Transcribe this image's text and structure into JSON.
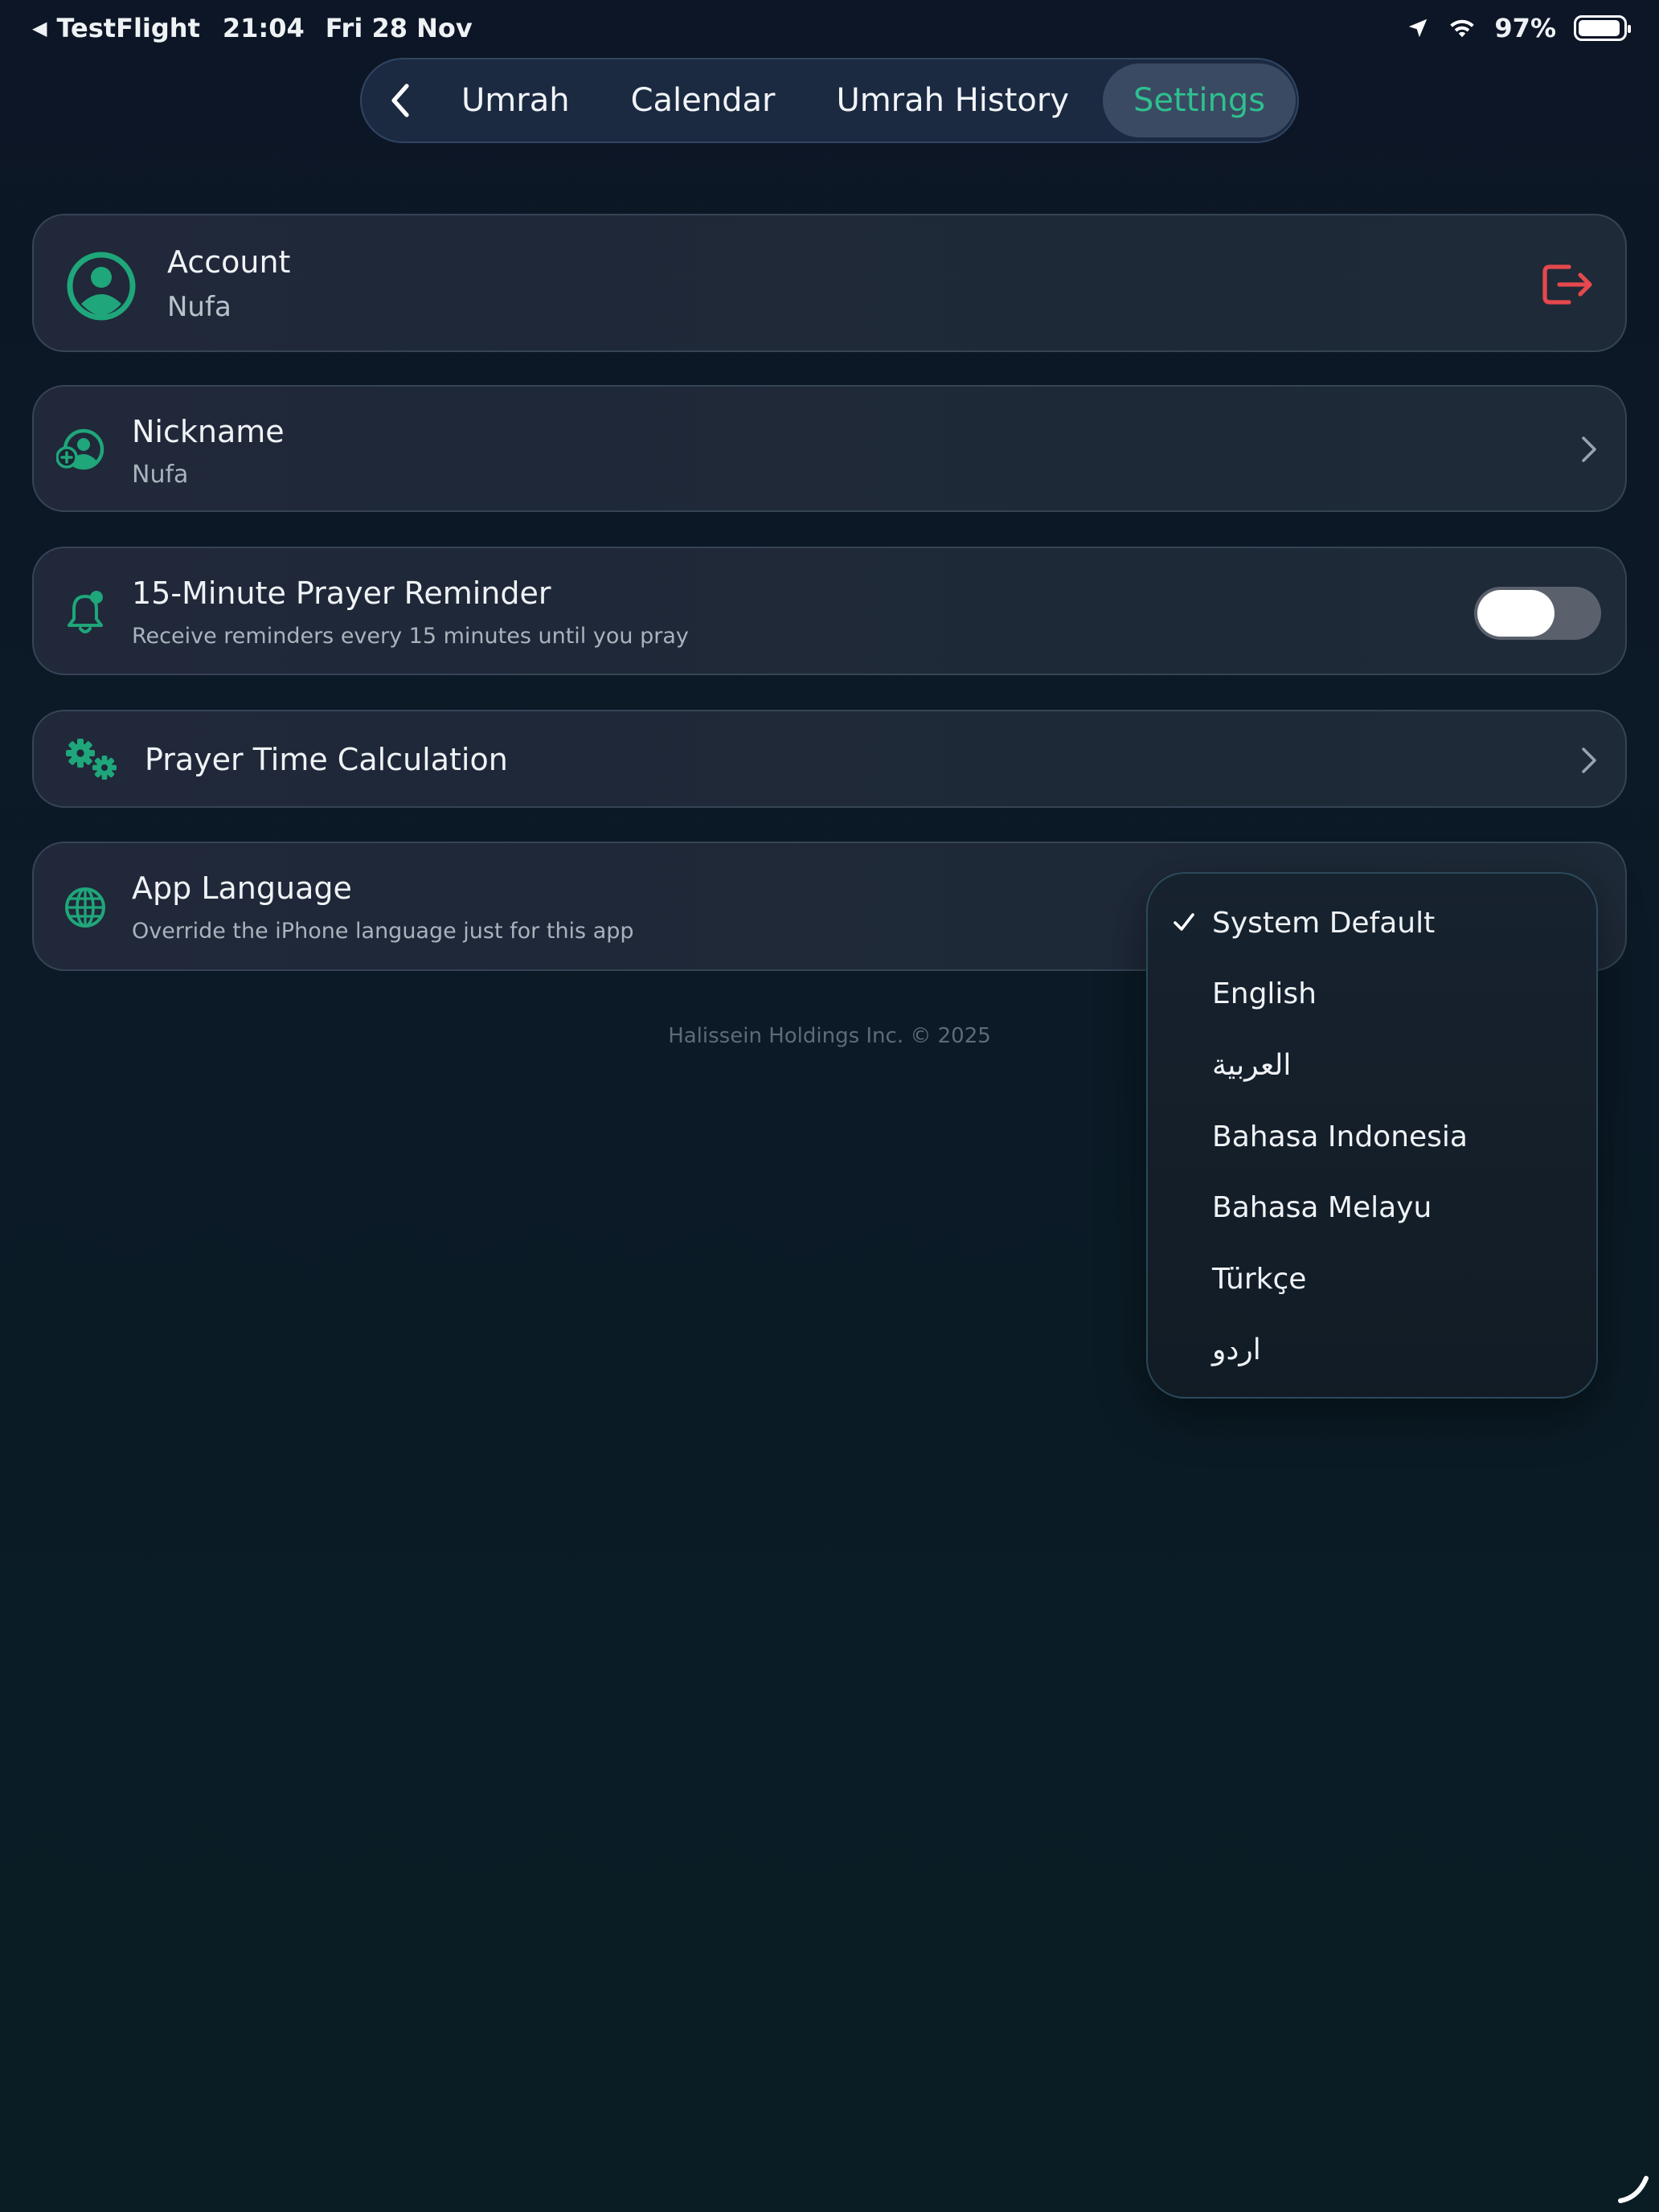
{
  "status_bar": {
    "back_app": "TestFlight",
    "time": "21:04",
    "date": "Fri 28 Nov",
    "battery": "97%"
  },
  "tabs": [
    {
      "label": "Umrah"
    },
    {
      "label": "Calendar"
    },
    {
      "label": "Umrah History"
    },
    {
      "label": "Settings"
    }
  ],
  "account": {
    "title": "Account",
    "name": "Nufa"
  },
  "nickname": {
    "title": "Nickname",
    "value": "Nufa"
  },
  "reminder": {
    "title": "15-Minute Prayer Reminder",
    "subtitle": "Receive reminders every 15 minutes until you pray",
    "enabled": false
  },
  "prayer_calc": {
    "title": "Prayer Time Calculation"
  },
  "language": {
    "title": "App Language",
    "subtitle": "Override the iPhone language just for this app",
    "selected": "System Default",
    "options": [
      {
        "label": "System Default"
      },
      {
        "label": "English"
      },
      {
        "label": "العربية"
      },
      {
        "label": "Bahasa Indonesia"
      },
      {
        "label": "Bahasa Melayu"
      },
      {
        "label": "Türkçe"
      },
      {
        "label": "اردو"
      }
    ]
  },
  "footer": "Halissein Holdings Inc. © 2025",
  "colors": {
    "accent": "#2fbf8f",
    "danger": "#e5484d",
    "background": "#0c1724"
  }
}
